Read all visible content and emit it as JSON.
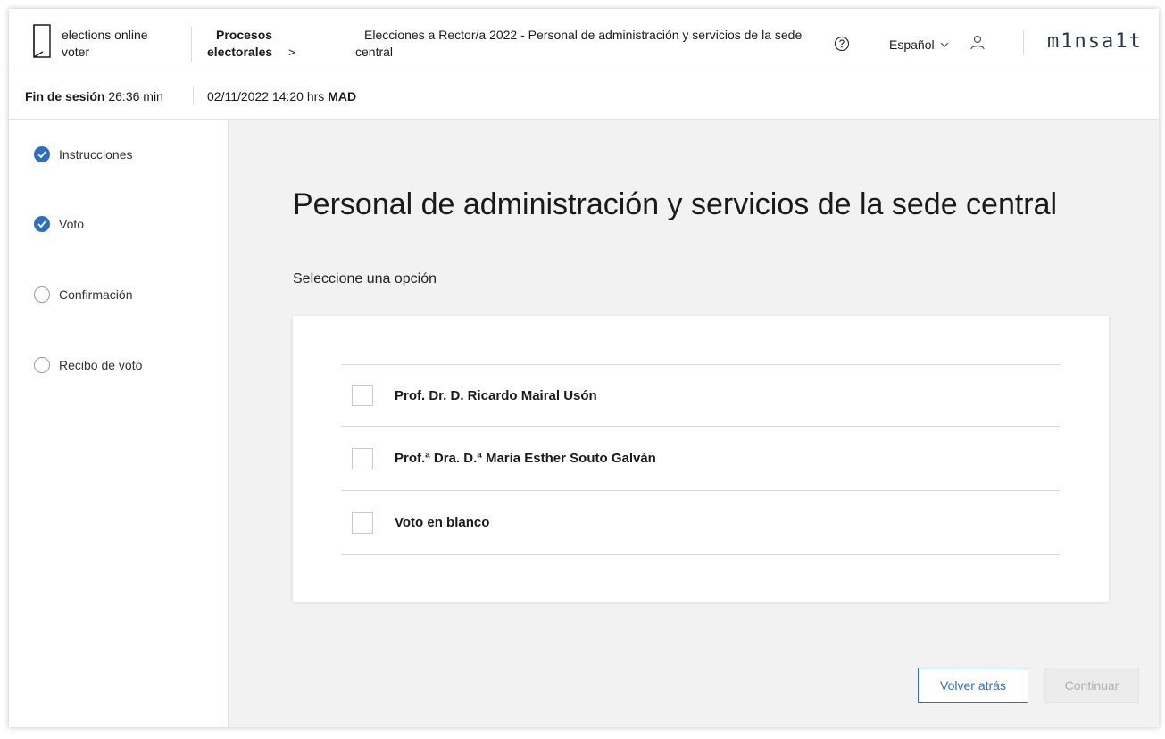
{
  "header": {
    "app_name": "elections online voter",
    "breadcrumb_root": [
      "Procesos",
      "electorales"
    ],
    "breadcrumb_separator": ">",
    "breadcrumb_current": "Elecciones a Rector/a 2022 - Personal de administración y servicios de la sede central",
    "help_icon": "help-circle-icon",
    "language": "Español",
    "user_icon": "user-icon",
    "brand": "m1nsa1t"
  },
  "session": {
    "label": "Fin de sesión",
    "remaining": "26:36 min",
    "datetime": "02/11/2022 14:20 hrs",
    "timezone": "MAD"
  },
  "steps": [
    {
      "label": "Instrucciones",
      "status": "done"
    },
    {
      "label": "Voto",
      "status": "done"
    },
    {
      "label": "Confirmación",
      "status": "pending"
    },
    {
      "label": "Recibo de voto",
      "status": "pending"
    }
  ],
  "main": {
    "title": "Personal de administración y servicios de la sede central",
    "subtitle": "Seleccione una opción",
    "options": [
      {
        "label": "Prof. Dr. D. Ricardo Mairal Usón",
        "checked": false
      },
      {
        "label": "Prof.ª Dra. D.ª María Esther Souto Galván",
        "checked": false
      },
      {
        "label": "Voto en blanco",
        "checked": false
      }
    ],
    "back_label": "Volver atrás",
    "continue_label": "Continuar"
  },
  "colors": {
    "accent": "#2f6fbf",
    "background": "#f2f2f2",
    "disabled": "#ececec"
  }
}
